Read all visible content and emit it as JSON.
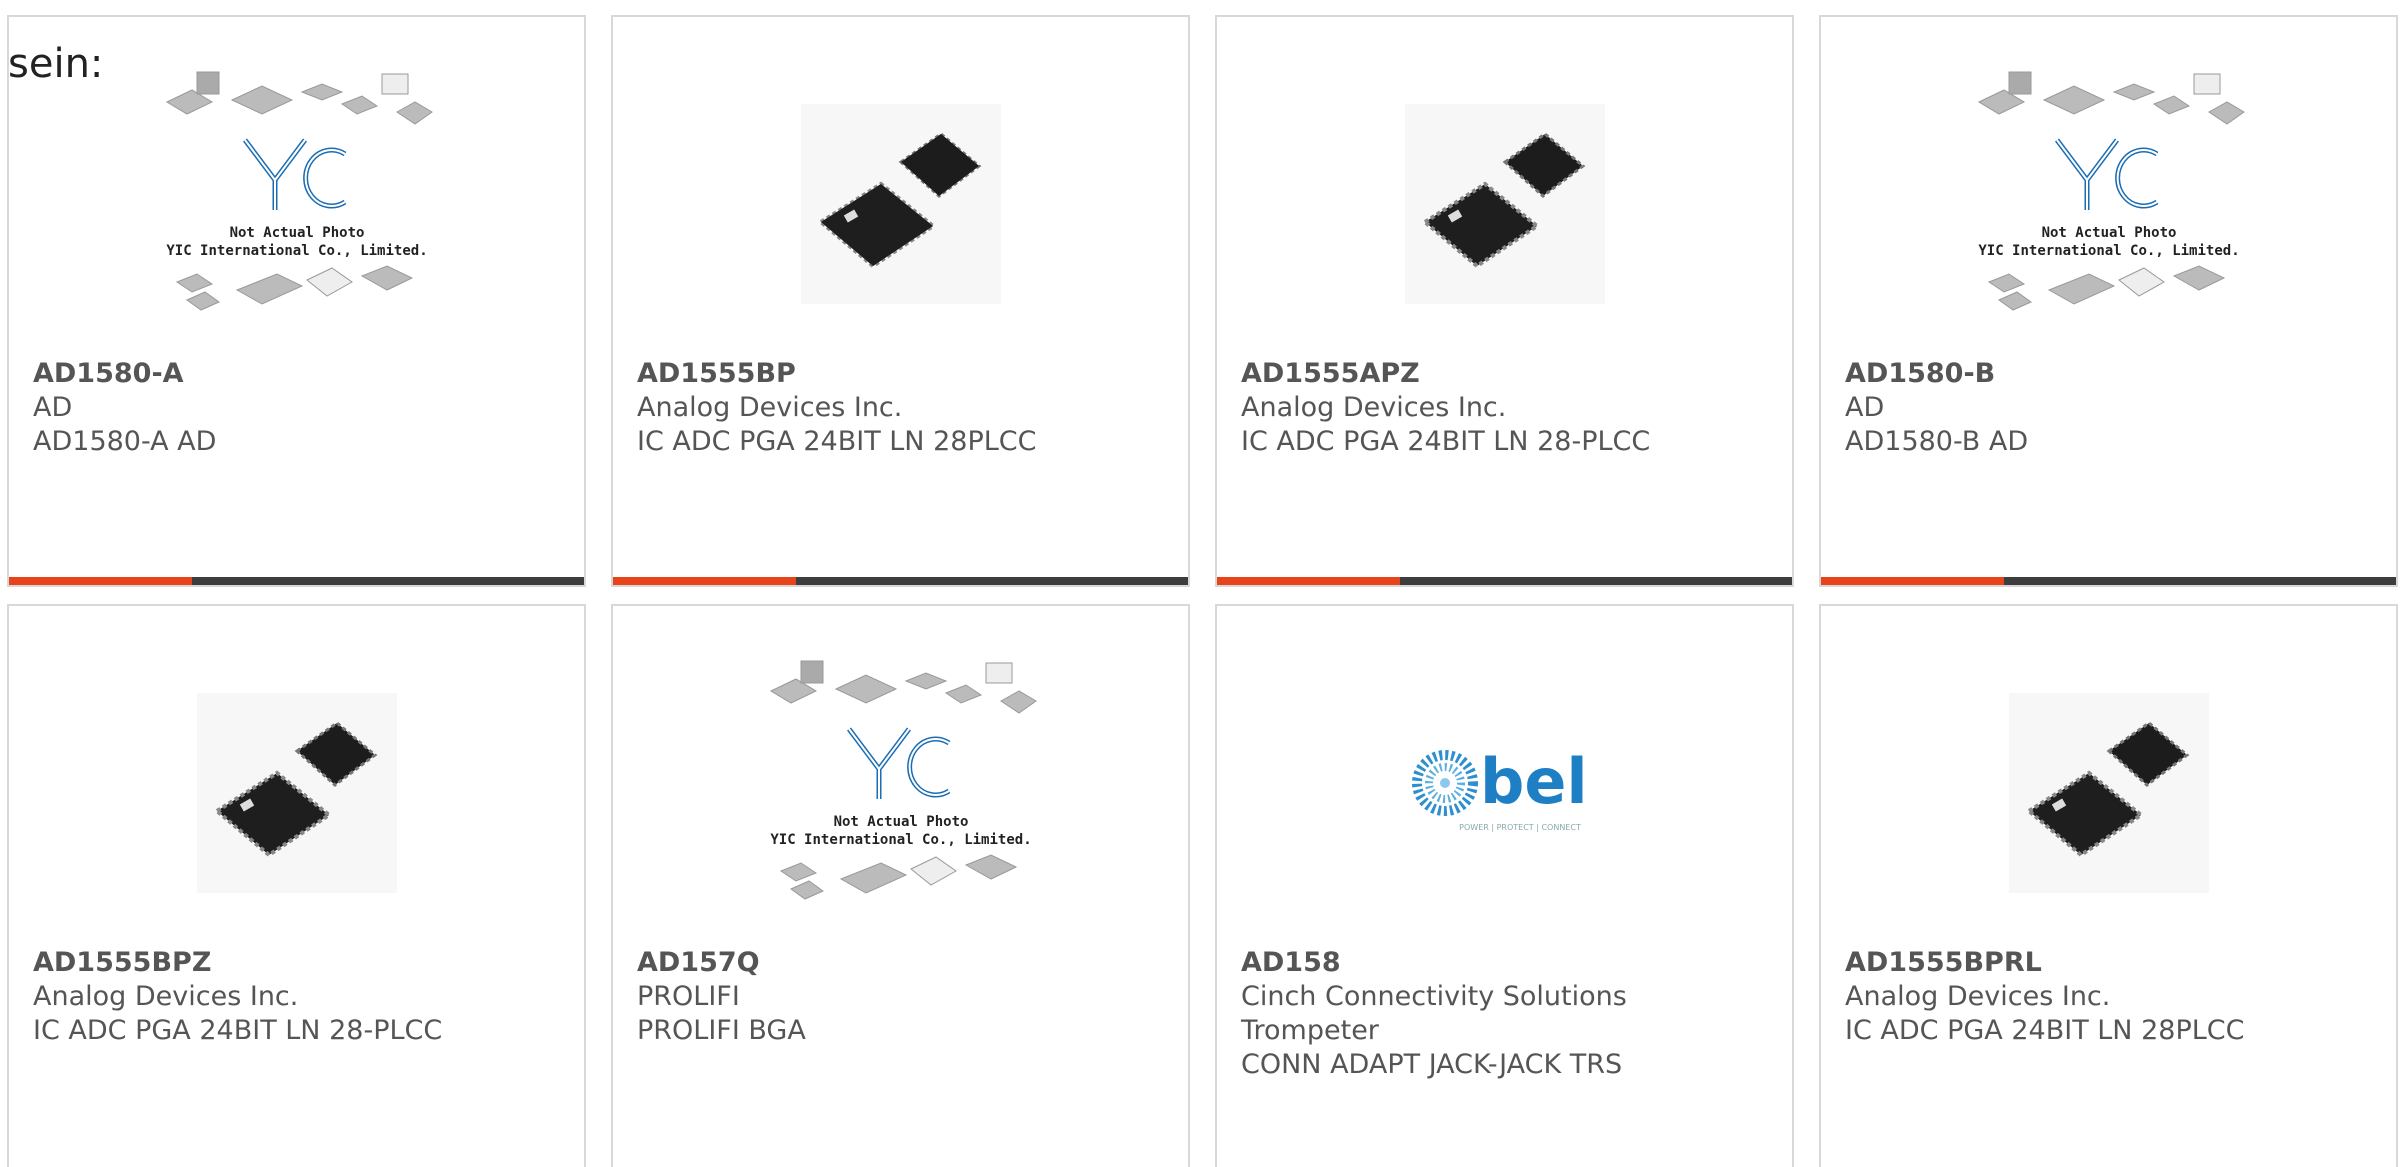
{
  "prefix_text": "sein:",
  "colors": {
    "accent": "#e8441b",
    "bar": "#3d3d3d",
    "text": "#555555",
    "border": "#d8d8d8",
    "bel_blue": "#1f7fc4",
    "yic_blue": "#1a6db3"
  },
  "products": [
    {
      "part": "AD1580-A",
      "line1": "AD",
      "line2": "AD1580-A AD",
      "line3": "",
      "image": "yic-placeholder",
      "image_caption1": "Not Actual Photo",
      "image_caption2": "YIC International Co., Limited.",
      "logo_text": "YIC"
    },
    {
      "part": "AD1555BP",
      "line1": "Analog Devices Inc.",
      "line2": "IC ADC PGA 24BIT LN 28PLCC",
      "line3": "",
      "image": "chip-photo"
    },
    {
      "part": "AD1555APZ",
      "line1": "Analog Devices Inc.",
      "line2": "IC ADC PGA 24BIT LN 28-PLCC",
      "line3": "",
      "image": "chip-photo"
    },
    {
      "part": "AD1580-B",
      "line1": "AD",
      "line2": "AD1580-B AD",
      "line3": "",
      "image": "yic-placeholder",
      "image_caption1": "Not Actual Photo",
      "image_caption2": "YIC International Co., Limited.",
      "logo_text": "YIC"
    },
    {
      "part": "AD1555BPZ",
      "line1": "Analog Devices Inc.",
      "line2": "IC ADC PGA 24BIT LN 28-PLCC",
      "line3": "",
      "image": "chip-photo"
    },
    {
      "part": "AD157Q",
      "line1": "PROLIFI",
      "line2": "PROLIFI BGA",
      "line3": "",
      "image": "yic-placeholder",
      "image_caption1": "Not Actual Photo",
      "image_caption2": "YIC International Co., Limited.",
      "logo_text": "YIC"
    },
    {
      "part": "AD158",
      "line1": "Cinch Connectivity Solutions",
      "line2": "Trompeter",
      "line3": "CONN ADAPT JACK-JACK TRS",
      "image": "bel-logo",
      "logo_text": "bel",
      "logo_tagline": "POWER | PROTECT | CONNECT"
    },
    {
      "part": "AD1555BPRL",
      "line1": "Analog Devices Inc.",
      "line2": "IC ADC PGA 24BIT LN 28PLCC",
      "line3": "",
      "image": "chip-photo"
    }
  ]
}
